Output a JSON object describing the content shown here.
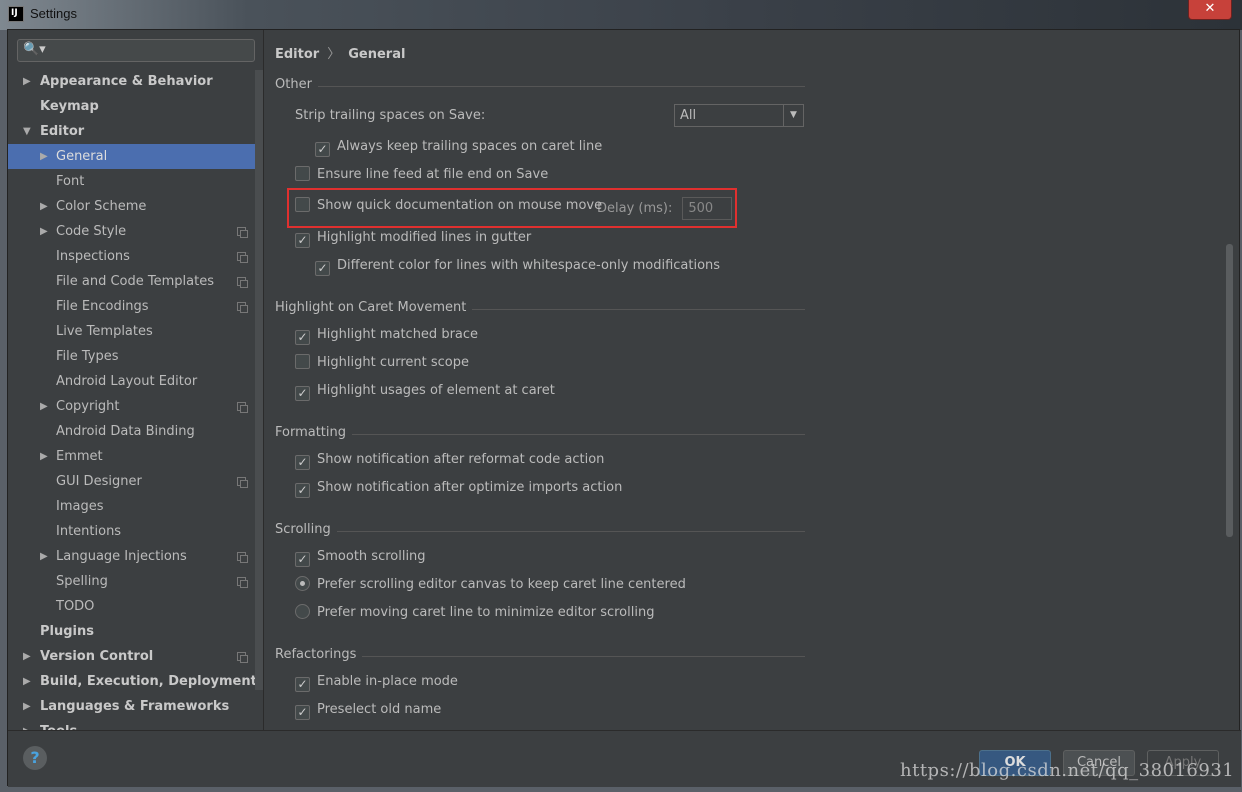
{
  "window": {
    "title": "Settings",
    "app_icon": "IJ",
    "close": "✕"
  },
  "search": {
    "icon": "search-icon",
    "glyph": "🔍▾"
  },
  "tree": [
    {
      "label": "Appearance & Behavior",
      "level": 0,
      "arrow": "▶",
      "bold": true
    },
    {
      "label": "Keymap",
      "level": 0,
      "arrow": "",
      "bold": true
    },
    {
      "label": "Editor",
      "level": 0,
      "arrow": "▼",
      "bold": true
    },
    {
      "label": "General",
      "level": 1,
      "arrow": "▶",
      "selected": true
    },
    {
      "label": "Font",
      "level": 1,
      "arrow": ""
    },
    {
      "label": "Color Scheme",
      "level": 1,
      "arrow": "▶"
    },
    {
      "label": "Code Style",
      "level": 1,
      "arrow": "▶",
      "copy": true
    },
    {
      "label": "Inspections",
      "level": 1,
      "arrow": "",
      "copy": true
    },
    {
      "label": "File and Code Templates",
      "level": 1,
      "arrow": "",
      "copy": true
    },
    {
      "label": "File Encodings",
      "level": 1,
      "arrow": "",
      "copy": true
    },
    {
      "label": "Live Templates",
      "level": 1,
      "arrow": ""
    },
    {
      "label": "File Types",
      "level": 1,
      "arrow": ""
    },
    {
      "label": "Android Layout Editor",
      "level": 1,
      "arrow": ""
    },
    {
      "label": "Copyright",
      "level": 1,
      "arrow": "▶",
      "copy": true
    },
    {
      "label": "Android Data Binding",
      "level": 1,
      "arrow": ""
    },
    {
      "label": "Emmet",
      "level": 1,
      "arrow": "▶"
    },
    {
      "label": "GUI Designer",
      "level": 1,
      "arrow": "",
      "copy": true
    },
    {
      "label": "Images",
      "level": 1,
      "arrow": ""
    },
    {
      "label": "Intentions",
      "level": 1,
      "arrow": ""
    },
    {
      "label": "Language Injections",
      "level": 1,
      "arrow": "▶",
      "copy": true
    },
    {
      "label": "Spelling",
      "level": 1,
      "arrow": "",
      "copy": true
    },
    {
      "label": "TODO",
      "level": 1,
      "arrow": ""
    },
    {
      "label": "Plugins",
      "level": 0,
      "arrow": "",
      "bold": true
    },
    {
      "label": "Version Control",
      "level": 0,
      "arrow": "▶",
      "bold": true,
      "copy": true
    },
    {
      "label": "Build, Execution, Deployment",
      "level": 0,
      "arrow": "▶",
      "bold": true
    },
    {
      "label": "Languages & Frameworks",
      "level": 0,
      "arrow": "▶",
      "bold": true
    },
    {
      "label": "Tools",
      "level": 0,
      "arrow": "▶",
      "bold": true
    }
  ],
  "breadcrumb": {
    "parent": "Editor",
    "sep": "〉",
    "current": "General"
  },
  "sections": {
    "other": "Other",
    "caret": "Highlight on Caret Movement",
    "formatting": "Formatting",
    "scrolling": "Scrolling",
    "refactorings": "Refactorings"
  },
  "strip": {
    "label": "Strip trailing spaces on Save:",
    "value": "All",
    "arrow": "▼"
  },
  "options": [
    {
      "label": "Always keep trailing spaces on caret line",
      "checked": true
    },
    {
      "label": "Ensure line feed at file end on Save",
      "checked": false
    },
    {
      "label": "Show quick documentation on mouse move",
      "checked": false
    },
    {
      "label": "Highlight modified lines in gutter",
      "checked": true
    },
    {
      "label": "Different color for lines with whitespace-only modifications",
      "checked": true
    },
    {
      "label": "Highlight matched brace",
      "checked": true
    },
    {
      "label": "Highlight current scope",
      "checked": false
    },
    {
      "label": "Highlight usages of element at caret",
      "checked": true
    },
    {
      "label": "Show notification after reformat code action",
      "checked": true
    },
    {
      "label": "Show notification after optimize imports action",
      "checked": true
    },
    {
      "label": "Smooth scrolling",
      "checked": true
    },
    {
      "label": "Prefer scrolling editor canvas to keep caret line centered",
      "radio": true,
      "checked": true
    },
    {
      "label": "Prefer moving caret line to minimize editor scrolling",
      "radio": true,
      "checked": false
    },
    {
      "label": "Enable in-place mode",
      "checked": true
    },
    {
      "label": "Preselect old name",
      "checked": true
    }
  ],
  "delay": {
    "label": "Delay (ms):",
    "value": "500"
  },
  "footer": {
    "help": "?",
    "ok": "OK",
    "cancel": "Cancel",
    "apply": "Apply"
  },
  "watermark": "https://blog.csdn.net/qq_38016931",
  "colors": {
    "selection": "#4b6eaf",
    "highlight_box": "#e0302f",
    "ok_button": "#365880"
  }
}
